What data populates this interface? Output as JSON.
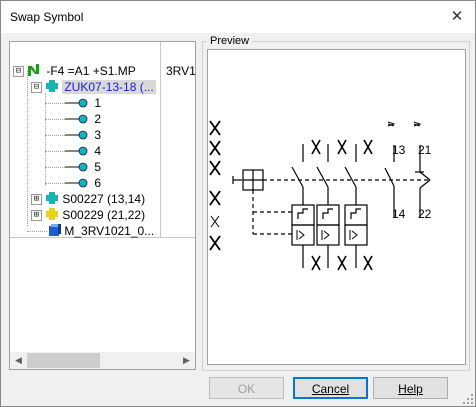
{
  "window": {
    "title": "Swap Symbol",
    "close_glyph": "✕"
  },
  "tree": {
    "column2_text": "3RV1",
    "nodes": [
      {
        "label": "-F4 =A1 +S1.MP",
        "icon": "device-icon",
        "expander": "⊟"
      },
      {
        "label": "ZUK07-13-18 (...",
        "icon": "contact-block-icon",
        "expander": "⊟",
        "selected": true
      },
      {
        "label": "1",
        "icon": "connection-point-icon"
      },
      {
        "label": "2",
        "icon": "connection-point-icon"
      },
      {
        "label": "3",
        "icon": "connection-point-icon"
      },
      {
        "label": "4",
        "icon": "connection-point-icon"
      },
      {
        "label": "5",
        "icon": "connection-point-icon"
      },
      {
        "label": "6",
        "icon": "connection-point-icon"
      },
      {
        "label": "S00227 (13,14)",
        "icon": "contact-block-icon",
        "expander": "⊞"
      },
      {
        "label": "S00229 (21,22)",
        "icon": "contact-block-yellow-icon",
        "expander": "⊞"
      },
      {
        "label": "M_3RV1021_0...",
        "icon": "part-icon"
      }
    ]
  },
  "preview": {
    "label": "Preview",
    "contact_labels": [
      "13",
      "14",
      "21",
      "22"
    ]
  },
  "buttons": {
    "ok": "OK",
    "cancel": "Cancel",
    "help": "Help"
  },
  "colors": {
    "selected_text": "#1a1adb",
    "accent": "#0078d7",
    "device_green": "#18a018",
    "contact_cyan": "#19b3b3"
  }
}
